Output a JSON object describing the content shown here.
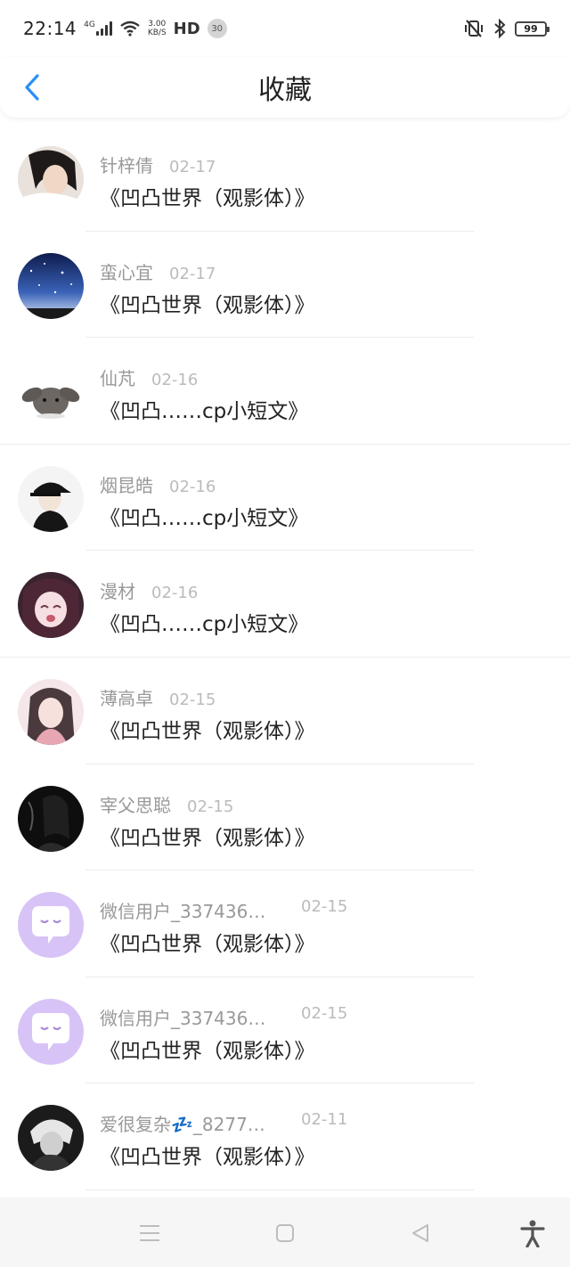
{
  "status_bar": {
    "time": "22:14",
    "network_type": "4G",
    "speed_value": "3.00",
    "speed_unit": "KB/S",
    "hd": "HD",
    "notification_count": "30",
    "battery": "99"
  },
  "header": {
    "title": "收藏",
    "back_icon": "chevron-left-icon",
    "accent_color": "#2a8ff7"
  },
  "items": [
    {
      "name": "针梓倩",
      "date": "02-17",
      "title": "《凹凸世界（观影体）》",
      "avatar": "photo-girl-avatar"
    },
    {
      "name": "蛮心宜",
      "date": "02-17",
      "title": "《凹凸世界（观影体）》",
      "avatar": "starry-sky-avatar"
    },
    {
      "name": "仙芃",
      "date": "02-16",
      "title": "《凹凸……cp小短文》",
      "avatar": "rabbit-avatar"
    },
    {
      "name": "烟昆皓",
      "date": "02-16",
      "title": "《凹凸……cp小短文》",
      "avatar": "boy-cap-avatar"
    },
    {
      "name": "漫材",
      "date": "02-16",
      "title": "《凹凸……cp小短文》",
      "avatar": "anime-girl-avatar"
    },
    {
      "name": "薄高卓",
      "date": "02-15",
      "title": "《凹凸世界（观影体）》",
      "avatar": "drawn-girl-avatar"
    },
    {
      "name": "宰父思聪",
      "date": "02-15",
      "title": "《凹凸世界（观影体）》",
      "avatar": "dark-smoke-avatar"
    },
    {
      "name": "微信用户_337436…",
      "date": "02-15",
      "title": "《凹凸世界（观影体）》",
      "avatar": "default-chat-avatar"
    },
    {
      "name": "微信用户_337436…",
      "date": "02-15",
      "title": "《凹凸世界（观影体）》",
      "avatar": "default-chat-avatar"
    },
    {
      "name": "爱很复杂💤_8277…",
      "date": "02-11",
      "title": "《凹凸世界（观影体）》",
      "avatar": "white-hair-avatar"
    }
  ],
  "nav_bar": {
    "menu_icon": "menu-icon",
    "home_icon": "home-square-icon",
    "back_icon": "back-triangle-icon",
    "accessibility_icon": "accessibility-icon"
  }
}
